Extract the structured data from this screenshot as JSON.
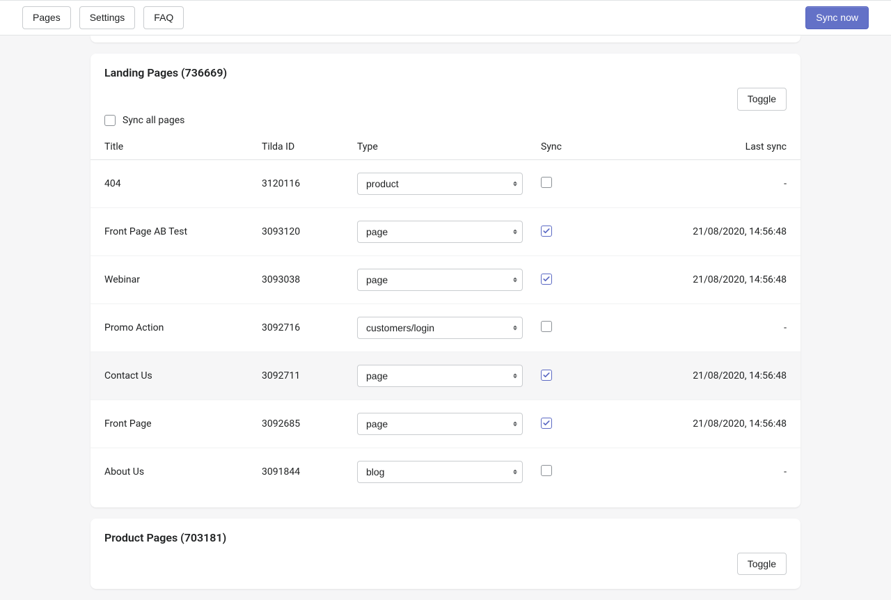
{
  "nav": {
    "pages": "Pages",
    "settings": "Settings",
    "faq": "FAQ",
    "sync_now": "Sync now"
  },
  "sync_all_label": "Sync all pages",
  "toggle_label": "Toggle",
  "columns": {
    "title": "Title",
    "tilda_id": "Tilda ID",
    "type": "Type",
    "sync": "Sync",
    "last_sync": "Last sync"
  },
  "type_options": [
    "product",
    "page",
    "customers/login",
    "blog"
  ],
  "sections": [
    {
      "heading": "Landing Pages (736669)",
      "rows": [
        {
          "title": "404",
          "tilda_id": "3120116",
          "type": "product",
          "sync": false,
          "last_sync": "-",
          "hover": false
        },
        {
          "title": "Front Page AB Test",
          "tilda_id": "3093120",
          "type": "page",
          "sync": true,
          "last_sync": "21/08/2020, 14:56:48",
          "hover": false
        },
        {
          "title": "Webinar",
          "tilda_id": "3093038",
          "type": "page",
          "sync": true,
          "last_sync": "21/08/2020, 14:56:48",
          "hover": false
        },
        {
          "title": "Promo Action",
          "tilda_id": "3092716",
          "type": "customers/login",
          "sync": false,
          "last_sync": "-",
          "hover": false
        },
        {
          "title": "Contact Us",
          "tilda_id": "3092711",
          "type": "page",
          "sync": true,
          "last_sync": "21/08/2020, 14:56:48",
          "hover": true
        },
        {
          "title": "Front Page",
          "tilda_id": "3092685",
          "type": "page",
          "sync": true,
          "last_sync": "21/08/2020, 14:56:48",
          "hover": false
        },
        {
          "title": "About Us",
          "tilda_id": "3091844",
          "type": "blog",
          "sync": false,
          "last_sync": "-",
          "hover": false
        }
      ]
    },
    {
      "heading": "Product Pages (703181)",
      "rows": []
    }
  ]
}
